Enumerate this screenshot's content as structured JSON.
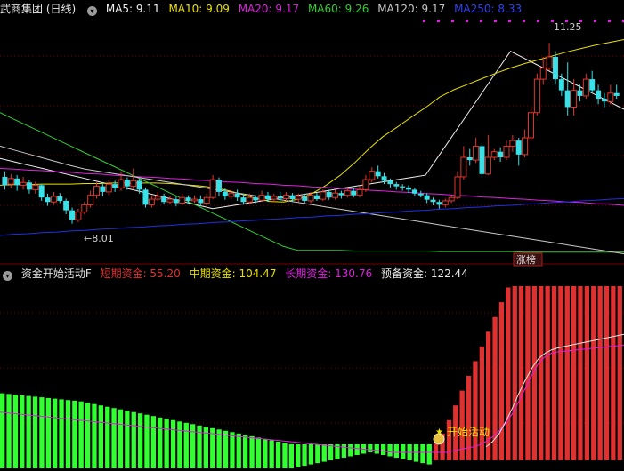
{
  "colors": {
    "up": "#e0362c",
    "down": "#38e0e8",
    "ma5": "#f0f0f0",
    "ma10": "#e8e000",
    "ma20": "#e020e0",
    "ma60": "#30d030",
    "ma120": "#c8c8c8",
    "ma250": "#2030e0",
    "short": "#e03030",
    "mid": "#e8e000",
    "long": "#e020e0",
    "reserve": "#e8e8e8"
  },
  "top_header": {
    "title": "武商集团 (日线)",
    "ma5": "MA5: 9.11",
    "ma10": "MA10: 9.09",
    "ma20": "MA20: 9.17",
    "ma60": "MA60: 9.26",
    "ma120": "MA120: 9.17",
    "ma250": "MA250: 8.33"
  },
  "bottom_header": {
    "title": "资金开始活动F",
    "short": "短期资金: 55.20",
    "mid": "中期资金: 104.47",
    "long": "长期资金: 130.76",
    "reserve": "预备资金: 122.44"
  },
  "annotations": {
    "high_label": "11.25",
    "low_label": "←8.01",
    "limit_up_badge": "涨榜",
    "start_label": "开始活动"
  },
  "chart_data": [
    {
      "type": "candlestick",
      "title": "武商集团 (日线)",
      "ylim": [
        7.4,
        11.7
      ],
      "high_marker": 11.25,
      "low_marker": 8.01,
      "candles": [
        [
          8.85,
          8.7,
          8.95,
          8.62
        ],
        [
          8.72,
          8.82,
          8.9,
          8.65
        ],
        [
          8.82,
          8.7,
          8.88,
          8.6
        ],
        [
          8.7,
          8.75,
          8.85,
          8.62
        ],
        [
          8.75,
          8.62,
          8.8,
          8.55
        ],
        [
          8.62,
          8.7,
          8.76,
          8.55
        ],
        [
          8.7,
          8.48,
          8.72,
          8.42
        ],
        [
          8.48,
          8.4,
          8.55,
          8.33
        ],
        [
          8.4,
          8.5,
          8.58,
          8.35
        ],
        [
          8.5,
          8.42,
          8.56,
          8.38
        ],
        [
          8.42,
          8.25,
          8.46,
          8.18
        ],
        [
          8.25,
          8.08,
          8.3,
          8.01
        ],
        [
          8.08,
          8.22,
          8.28,
          8.04
        ],
        [
          8.22,
          8.35,
          8.4,
          8.18
        ],
        [
          8.35,
          8.52,
          8.6,
          8.3
        ],
        [
          8.52,
          8.68,
          8.75,
          8.46
        ],
        [
          8.68,
          8.58,
          8.72,
          8.5
        ],
        [
          8.58,
          8.72,
          8.8,
          8.52
        ],
        [
          8.72,
          8.65,
          8.78,
          8.58
        ],
        [
          8.65,
          8.8,
          8.95,
          8.6
        ],
        [
          8.8,
          8.68,
          8.84,
          8.62
        ],
        [
          8.68,
          8.78,
          9.0,
          8.62
        ],
        [
          8.78,
          8.62,
          8.82,
          8.55
        ],
        [
          8.62,
          8.35,
          8.66,
          8.3
        ],
        [
          8.35,
          8.45,
          8.52,
          8.3
        ],
        [
          8.45,
          8.5,
          8.58,
          8.42
        ],
        [
          8.5,
          8.4,
          8.55,
          8.36
        ],
        [
          8.4,
          8.45,
          8.5,
          8.36
        ],
        [
          8.45,
          8.38,
          8.5,
          8.32
        ],
        [
          8.38,
          8.48,
          8.55,
          8.34
        ],
        [
          8.48,
          8.42,
          8.52,
          8.36
        ],
        [
          8.42,
          8.45,
          8.52,
          8.38
        ],
        [
          8.45,
          8.38,
          8.52,
          8.32
        ],
        [
          8.38,
          8.48,
          8.55,
          8.33
        ],
        [
          8.48,
          8.8,
          8.88,
          8.45
        ],
        [
          8.8,
          8.58,
          8.84,
          8.5
        ],
        [
          8.58,
          8.5,
          8.64,
          8.44
        ],
        [
          8.5,
          8.55,
          8.62,
          8.45
        ],
        [
          8.55,
          8.48,
          8.62,
          8.42
        ],
        [
          8.48,
          8.4,
          8.55,
          8.35
        ],
        [
          8.4,
          8.48,
          8.55,
          8.36
        ],
        [
          8.48,
          8.43,
          8.52,
          8.38
        ],
        [
          8.43,
          8.52,
          8.6,
          8.4
        ],
        [
          8.52,
          8.45,
          8.58,
          8.4
        ],
        [
          8.45,
          8.5,
          8.55,
          8.4
        ],
        [
          8.5,
          8.46,
          8.58,
          8.42
        ],
        [
          8.46,
          8.52,
          8.58,
          8.42
        ],
        [
          8.52,
          8.45,
          8.56,
          8.4
        ],
        [
          8.45,
          8.5,
          8.55,
          8.4
        ],
        [
          8.5,
          8.42,
          8.55,
          8.38
        ],
        [
          8.42,
          8.52,
          8.58,
          8.38
        ],
        [
          8.52,
          8.45,
          8.56,
          8.42
        ],
        [
          8.45,
          8.58,
          8.62,
          8.42
        ],
        [
          8.58,
          8.48,
          8.62,
          8.44
        ],
        [
          8.48,
          8.56,
          8.62,
          8.44
        ],
        [
          8.56,
          8.52,
          8.6,
          8.46
        ],
        [
          8.52,
          8.6,
          8.66,
          8.48
        ],
        [
          8.6,
          8.52,
          8.65,
          8.48
        ],
        [
          8.52,
          8.62,
          8.68,
          8.48
        ],
        [
          8.62,
          8.8,
          8.88,
          8.58
        ],
        [
          8.8,
          8.95,
          9.02,
          8.75
        ],
        [
          8.95,
          8.86,
          9.05,
          8.82
        ],
        [
          8.86,
          8.78,
          8.92,
          8.72
        ],
        [
          8.78,
          8.72,
          8.82,
          8.66
        ],
        [
          8.72,
          8.68,
          8.76,
          8.62
        ],
        [
          8.68,
          8.66,
          8.72,
          8.6
        ],
        [
          8.66,
          8.62,
          8.7,
          8.56
        ],
        [
          8.62,
          8.55,
          8.66,
          8.5
        ],
        [
          8.55,
          8.52,
          8.6,
          8.48
        ],
        [
          8.52,
          8.44,
          8.56,
          8.38
        ],
        [
          8.44,
          8.4,
          8.48,
          8.34
        ],
        [
          8.4,
          8.35,
          8.44,
          8.28
        ],
        [
          8.35,
          8.42,
          8.46,
          8.3
        ],
        [
          8.42,
          8.48,
          8.52,
          8.38
        ],
        [
          8.48,
          8.85,
          8.95,
          8.45
        ],
        [
          8.85,
          9.2,
          9.4,
          8.8
        ],
        [
          9.2,
          9.15,
          9.35,
          9.05
        ],
        [
          9.15,
          9.4,
          9.55,
          9.1
        ],
        [
          9.4,
          8.9,
          9.45,
          8.85
        ],
        [
          8.9,
          9.2,
          9.6,
          8.88
        ],
        [
          9.2,
          9.3,
          9.35,
          9.15
        ],
        [
          9.3,
          9.2,
          9.38,
          9.12
        ],
        [
          9.2,
          9.4,
          9.5,
          9.15
        ],
        [
          9.4,
          9.5,
          9.6,
          9.3
        ],
        [
          9.5,
          9.25,
          9.55,
          9.05
        ],
        [
          9.25,
          9.55,
          9.7,
          9.2
        ],
        [
          9.55,
          10.0,
          10.1,
          9.5
        ],
        [
          10.0,
          10.6,
          10.7,
          9.95
        ],
        [
          10.6,
          10.8,
          11.0,
          10.5
        ],
        [
          10.8,
          11.0,
          11.25,
          10.75
        ],
        [
          11.0,
          10.6,
          11.1,
          10.5
        ],
        [
          10.6,
          10.4,
          10.7,
          10.3
        ],
        [
          10.4,
          10.1,
          10.9,
          9.95
        ],
        [
          10.1,
          10.4,
          10.6,
          9.95
        ],
        [
          10.4,
          10.3,
          10.5,
          10.2
        ],
        [
          10.3,
          10.6,
          10.7,
          10.25
        ],
        [
          10.6,
          10.4,
          10.75,
          10.35
        ],
        [
          10.4,
          10.25,
          10.5,
          10.15
        ],
        [
          10.25,
          10.2,
          10.35,
          10.1
        ],
        [
          10.2,
          10.35,
          10.5,
          10.15
        ],
        [
          10.35,
          10.3,
          10.5,
          10.25
        ]
      ],
      "ma_series": [
        {
          "name": "MA5",
          "values": [
            9.18,
            9.12,
            9.06,
            9.0,
            8.94,
            8.88,
            8.82,
            8.76,
            8.7,
            8.64,
            8.58,
            8.52,
            8.46,
            8.4,
            8.34,
            8.28,
            8.32,
            8.36,
            8.4,
            8.44,
            8.48,
            8.52,
            8.56,
            8.6,
            8.64,
            8.68,
            8.72,
            8.76,
            8.8,
            8.84,
            8.88,
            9.25,
            9.62,
            9.99,
            10.36,
            10.73,
            11.1,
            10.97,
            10.84,
            10.71,
            10.58,
            10.45,
            10.32,
            10.19,
            10.06
          ]
        },
        {
          "name": "MA10",
          "values": [
            8.7,
            8.71,
            8.71,
            8.72,
            8.72,
            8.72,
            8.73,
            8.73,
            8.74,
            8.74,
            8.74,
            8.74,
            8.73,
            8.71,
            8.69,
            8.66,
            8.61,
            8.54,
            8.47,
            8.41,
            8.4,
            8.45,
            8.55,
            8.7,
            8.88,
            9.1,
            9.35,
            9.57,
            9.74,
            9.92,
            10.09,
            10.28,
            10.41,
            10.51,
            10.61,
            10.71,
            10.8,
            10.88,
            10.95,
            11.02,
            11.09,
            11.15,
            11.21,
            11.26,
            11.31
          ]
        },
        {
          "name": "MA20",
          "values": [
            9.0,
            8.99,
            8.97,
            8.96,
            8.94,
            8.93,
            8.91,
            8.9,
            8.88,
            8.87,
            8.85,
            8.84,
            8.82,
            8.81,
            8.79,
            8.78,
            8.76,
            8.75,
            8.73,
            8.72,
            8.7,
            8.69,
            8.67,
            8.66,
            8.64,
            8.63,
            8.61,
            8.6,
            8.58,
            8.57,
            8.55,
            8.54,
            8.52,
            8.51,
            8.49,
            8.48,
            8.46,
            8.45,
            8.43,
            8.42,
            8.4,
            8.39,
            8.37,
            8.36,
            8.34
          ]
        },
        {
          "name": "MA60",
          "values": [
            10.0,
            9.88,
            9.76,
            9.64,
            9.52,
            9.4,
            9.28,
            9.16,
            9.04,
            8.92,
            8.8,
            8.68,
            8.56,
            8.44,
            8.32,
            8.2,
            8.08,
            7.96,
            7.84,
            7.72,
            7.6,
            7.53,
            7.53,
            7.53,
            7.53,
            7.52,
            7.52,
            7.52,
            7.52,
            7.52,
            7.52,
            7.51,
            7.51,
            7.51,
            7.51,
            7.51,
            7.51,
            7.5,
            7.5,
            7.5,
            7.5,
            7.5,
            7.5,
            7.5,
            7.5
          ]
        },
        {
          "name": "MA120",
          "values": [
            9.4,
            9.33,
            9.26,
            9.19,
            9.12,
            9.05,
            8.99,
            8.95,
            8.91,
            8.87,
            8.83,
            8.79,
            8.75,
            8.71,
            8.67,
            8.63,
            8.59,
            8.55,
            8.51,
            8.47,
            8.43,
            8.39,
            8.35,
            8.31,
            8.27,
            8.23,
            8.19,
            8.15,
            8.11,
            8.07,
            8.03,
            7.99,
            7.95,
            7.91,
            7.87,
            7.83,
            7.79,
            7.75,
            7.71,
            7.67,
            7.63,
            7.59,
            7.55,
            7.51,
            7.47
          ]
        },
        {
          "name": "MA250",
          "values": [
            7.8,
            7.82,
            7.83,
            7.85,
            7.86,
            7.88,
            7.89,
            7.91,
            7.92,
            7.94,
            7.95,
            7.97,
            7.98,
            8.0,
            8.01,
            8.03,
            8.04,
            8.06,
            8.07,
            8.09,
            8.1,
            8.12,
            8.13,
            8.15,
            8.16,
            8.18,
            8.19,
            8.21,
            8.22,
            8.24,
            8.25,
            8.27,
            8.28,
            8.3,
            8.31,
            8.33,
            8.34,
            8.36,
            8.37,
            8.39,
            8.4,
            8.42,
            8.43,
            8.45,
            8.46
          ]
        }
      ]
    },
    {
      "type": "bar",
      "title": "资金开始活动F",
      "ylim": [
        -20,
        240
      ],
      "bars": [
        80,
        79,
        78,
        77,
        76,
        75,
        74,
        73,
        72,
        71,
        70,
        69,
        68,
        66,
        64,
        62,
        60,
        58,
        56,
        54,
        52,
        50,
        48,
        46,
        44,
        42,
        40,
        38,
        36,
        34,
        32,
        30,
        28,
        26,
        24,
        22,
        20,
        18,
        16,
        14,
        12,
        10,
        8,
        6,
        4,
        2,
        0,
        -2,
        -4,
        -6,
        -8,
        -10,
        -12,
        -14,
        -16,
        -18,
        -20,
        -18,
        -16,
        -14,
        -12,
        -10,
        -8,
        -6,
        -4,
        -2,
        5,
        20,
        40,
        62,
        84,
        106,
        128,
        150,
        172,
        194,
        216,
        238,
        240,
        240,
        240,
        240,
        240,
        240,
        240,
        240,
        240,
        240,
        240,
        240,
        240,
        240,
        240,
        240,
        240
      ],
      "lines": [
        {
          "name": "长期资金",
          "values": [
            52,
            51,
            50,
            49,
            48,
            47,
            46,
            45,
            44,
            43,
            42,
            41,
            40,
            39,
            38,
            37,
            36,
            35,
            34,
            33,
            32,
            31,
            30,
            29,
            28,
            27,
            26,
            25,
            24,
            23,
            22,
            21,
            20,
            19,
            18,
            17,
            16,
            15,
            14,
            13,
            12,
            11,
            10,
            9,
            8,
            7,
            6,
            5,
            4,
            3,
            2,
            1,
            0,
            -1,
            -2,
            -3,
            -4,
            -5,
            -6,
            -7,
            -8,
            -8,
            -8,
            -8,
            -8,
            -8,
            -8,
            -8,
            -8,
            -6,
            -4,
            -2,
            0,
            3,
            8,
            15,
            24,
            35,
            50,
            68,
            88,
            108,
            125,
            135,
            140,
            142,
            143,
            144,
            145,
            146,
            147,
            148,
            149,
            150,
            151,
            152
          ]
        },
        {
          "name": "中期资金",
          "values": [
            null,
            null,
            null,
            null,
            null,
            null,
            null,
            null,
            null,
            null,
            null,
            null,
            null,
            null,
            null,
            null,
            null,
            null,
            null,
            null,
            null,
            null,
            null,
            null,
            null,
            null,
            null,
            null,
            null,
            null,
            null,
            null,
            null,
            null,
            null,
            null,
            null,
            null,
            null,
            null,
            null,
            null,
            null,
            null,
            null,
            null,
            null,
            null,
            null,
            null,
            null,
            null,
            null,
            null,
            null,
            null,
            null,
            null,
            null,
            null,
            null,
            null,
            null,
            null,
            null,
            null,
            null,
            null,
            null,
            null,
            null,
            null,
            null,
            null,
            0,
            8,
            20,
            38,
            58,
            80,
            100,
            118,
            132,
            140,
            145,
            148,
            150,
            152,
            154,
            156,
            158,
            160,
            162,
            164,
            166,
            168
          ]
        }
      ]
    }
  ]
}
